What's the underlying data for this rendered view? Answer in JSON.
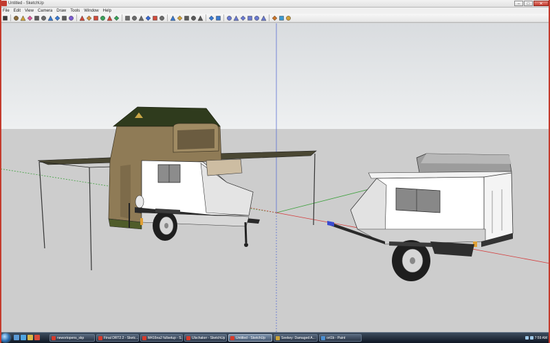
{
  "window": {
    "title": "Untitled - SketchUp"
  },
  "menu": [
    "File",
    "Edit",
    "View",
    "Camera",
    "Draw",
    "Tools",
    "Window",
    "Help"
  ],
  "toolbar": {
    "tools": [
      "select-tool",
      "make-component-tool",
      "paint-bucket-tool",
      "eraser-tool",
      "rectangle-tool",
      "line-tool",
      "circle-tool",
      "arc-tool",
      "polygon-tool",
      "freehand-tool",
      "move-tool",
      "push-pull-tool",
      "rotate-tool",
      "follow-me-tool",
      "scale-tool",
      "offset-tool",
      "tape-measure-tool",
      "dimension-tool",
      "protractor-tool",
      "text-tool",
      "axes-tool",
      "3d-text-tool",
      "orbit-tool",
      "pan-tool",
      "zoom-tool",
      "zoom-window-tool",
      "zoom-extents-tool",
      "previous-view-tool",
      "next-view-tool",
      "iso-view-tool",
      "top-view-tool",
      "front-view-tool",
      "right-view-tool",
      "back-view-tool",
      "left-view-tool",
      "3d-warehouse-tool",
      "share-model-tool",
      "get-models-tool"
    ]
  },
  "colors": {
    "sky": "#e6e8ea",
    "ground": "#cdcdcd",
    "axis_red": "#d43a3a",
    "axis_green": "#3aa03a",
    "axis_blue": "#5a6fd4",
    "tent": "#8f7b56",
    "tent_roof": "#2f3b1d",
    "awning": "#4a4733",
    "trailer_body": "#ffffff",
    "trailer_nose": "#e4e4e4",
    "chassis": "#2a2a2a"
  },
  "taskbar": {
    "items": [
      {
        "label": "newortopens_skp",
        "active": false
      },
      {
        "label": "Final DRT2.2 - Sketc...",
        "active": false
      },
      {
        "label": "M416na2 fullsetup - S...",
        "active": false
      },
      {
        "label": "Ulschaker - SketchUp",
        "active": false
      },
      {
        "label": "Untitled - SketchUp",
        "active": true
      },
      {
        "label": "Seekey: Damaged A...",
        "active": false
      },
      {
        "label": "ort1b - Paint",
        "active": false
      }
    ],
    "clock": "7:59 AM"
  }
}
